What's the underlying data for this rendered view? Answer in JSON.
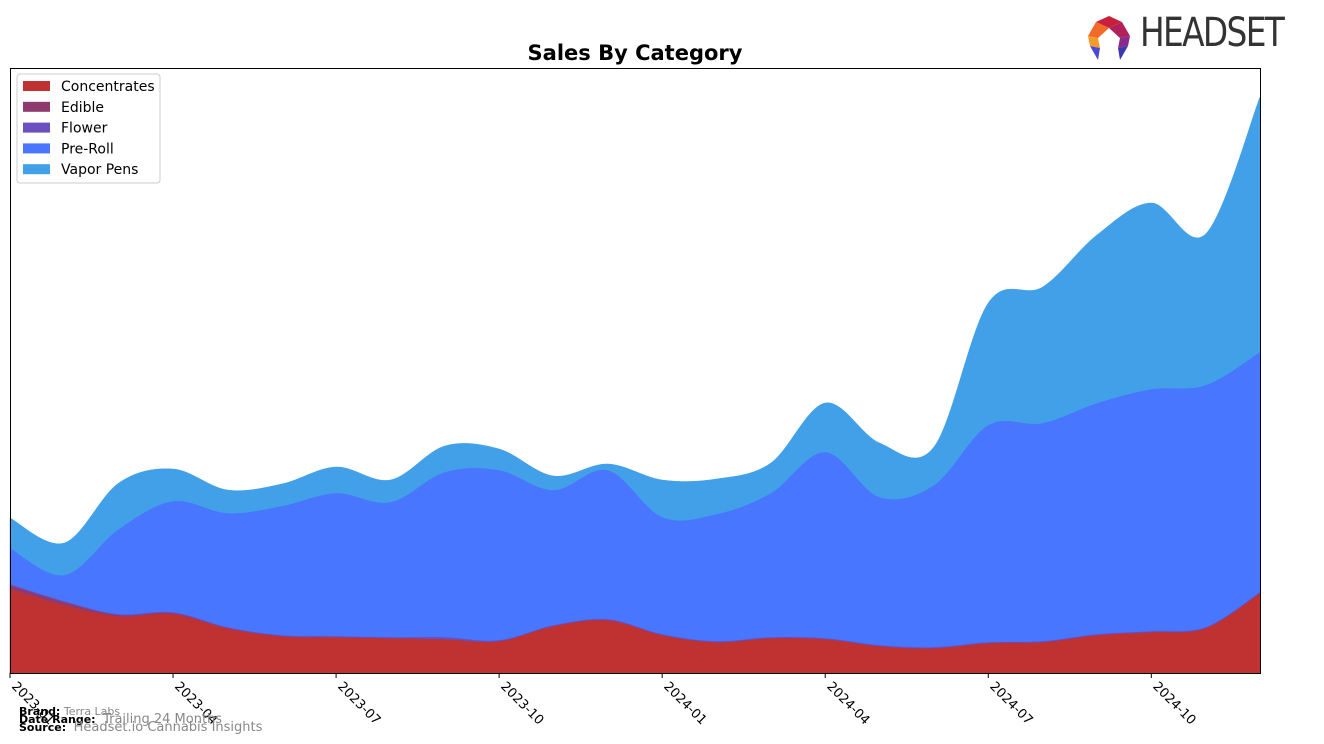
{
  "brand_logo": {
    "text": "HEADSET",
    "icon": "headset-logo-icon"
  },
  "footer": {
    "brand_label": "Brand:",
    "brand_value": "Terra Labs",
    "date_label": "Date Range:",
    "date_value": "Trailing 24 Months",
    "source_label": "Source:",
    "source_value": "Headset.io Cannabis Insights"
  },
  "chart_data": {
    "type": "area",
    "stacked": true,
    "smoothed": true,
    "title": "Sales By Category",
    "xlabel": "",
    "ylabel": "",
    "y_axis_labels_visible": false,
    "grid": false,
    "legend_position": "top-left",
    "x": [
      "2023-01",
      "2023-02",
      "2023-03",
      "2023-04",
      "2023-05",
      "2023-06",
      "2023-07",
      "2023-08",
      "2023-09",
      "2023-10",
      "2023-11",
      "2023-12",
      "2024-01",
      "2024-02",
      "2024-03",
      "2024-04",
      "2024-05",
      "2024-06",
      "2024-07",
      "2024-08",
      "2024-09",
      "2024-10",
      "2024-11",
      "2024-12"
    ],
    "x_tick_labels": [
      "2023-01",
      "2023-04",
      "2023-07",
      "2023-10",
      "2024-01",
      "2024-04",
      "2024-07",
      "2024-10"
    ],
    "x_tick_indices": [
      0,
      3,
      6,
      9,
      12,
      15,
      18,
      21
    ],
    "ylim": [
      0,
      605
    ],
    "series": [
      {
        "name": "Concentrates",
        "color": "#c03232",
        "values": [
          84,
          68,
          57,
          59,
          45,
          37,
          36,
          35,
          34,
          32,
          47,
          53,
          38,
          31,
          35,
          34,
          27,
          25,
          30,
          31,
          38,
          41,
          45,
          80
        ]
      },
      {
        "name": "Edible",
        "color": "#8e3a6e",
        "values": [
          4,
          3,
          1,
          1,
          0,
          0,
          0,
          0,
          0,
          0,
          0,
          0,
          0,
          0,
          0,
          0,
          0,
          0,
          0,
          0,
          0,
          0,
          0,
          0
        ]
      },
      {
        "name": "Flower",
        "color": "#6a4fc0",
        "values": [
          1,
          1,
          1,
          1,
          1,
          1,
          1,
          1,
          2,
          1,
          1,
          1,
          1,
          1,
          1,
          1,
          1,
          1,
          1,
          1,
          1,
          1,
          1,
          1
        ]
      },
      {
        "name": "Pre-Roll",
        "color": "#4876ff",
        "values": [
          36,
          26,
          85,
          111,
          114,
          129,
          143,
          135,
          165,
          170,
          135,
          149,
          117,
          127,
          144,
          186,
          148,
          162,
          217,
          218,
          231,
          242,
          242,
          240
        ]
      },
      {
        "name": "Vapor Pens",
        "color": "#41a0e8",
        "values": [
          30,
          32,
          46,
          32,
          23,
          22,
          26,
          22,
          26,
          21,
          14,
          6,
          37,
          35,
          30,
          49,
          54,
          38,
          122,
          136,
          168,
          186,
          151,
          255
        ]
      }
    ]
  }
}
